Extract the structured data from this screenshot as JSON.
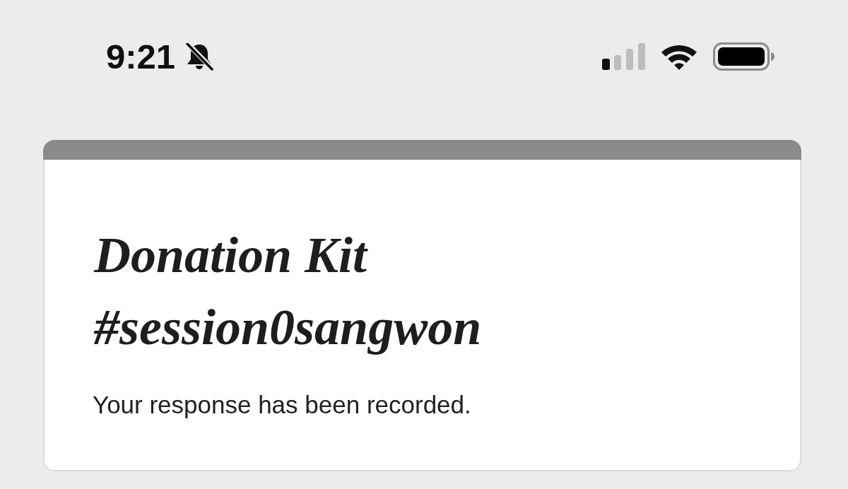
{
  "status_bar": {
    "time": "9:21",
    "silent": true
  },
  "form": {
    "title": "Donation Kit #session0sangwon",
    "message": "Your response has been recorded."
  }
}
